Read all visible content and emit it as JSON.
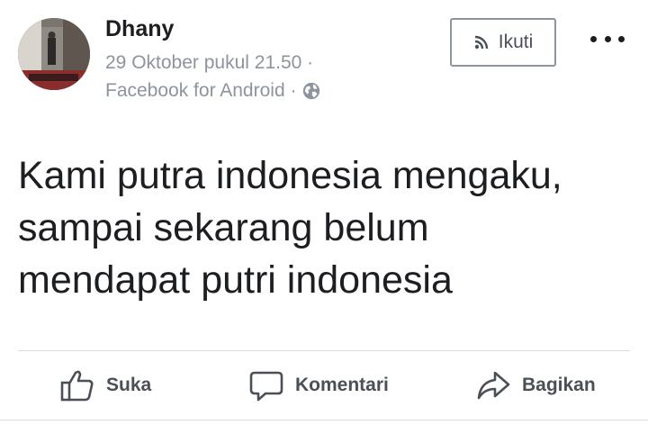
{
  "post": {
    "author": "Dhany",
    "timestamp": "29 Oktober pukul 21.50 ·",
    "source": "Facebook for Android ·",
    "privacy_icon": "globe-icon",
    "follow_label": "Ikuti",
    "text_lines": [
      "Kami putra indonesia mengaku,",
      "sampai sekarang belum",
      "mendapat putri indonesia"
    ]
  },
  "actions": {
    "like_label": "Suka",
    "comment_label": "Komentari",
    "share_label": "Bagikan"
  },
  "colors": {
    "primary_text": "#1c1e21",
    "secondary_text": "#8d949e",
    "action_text": "#4b4f56",
    "divider": "#dadde1"
  }
}
